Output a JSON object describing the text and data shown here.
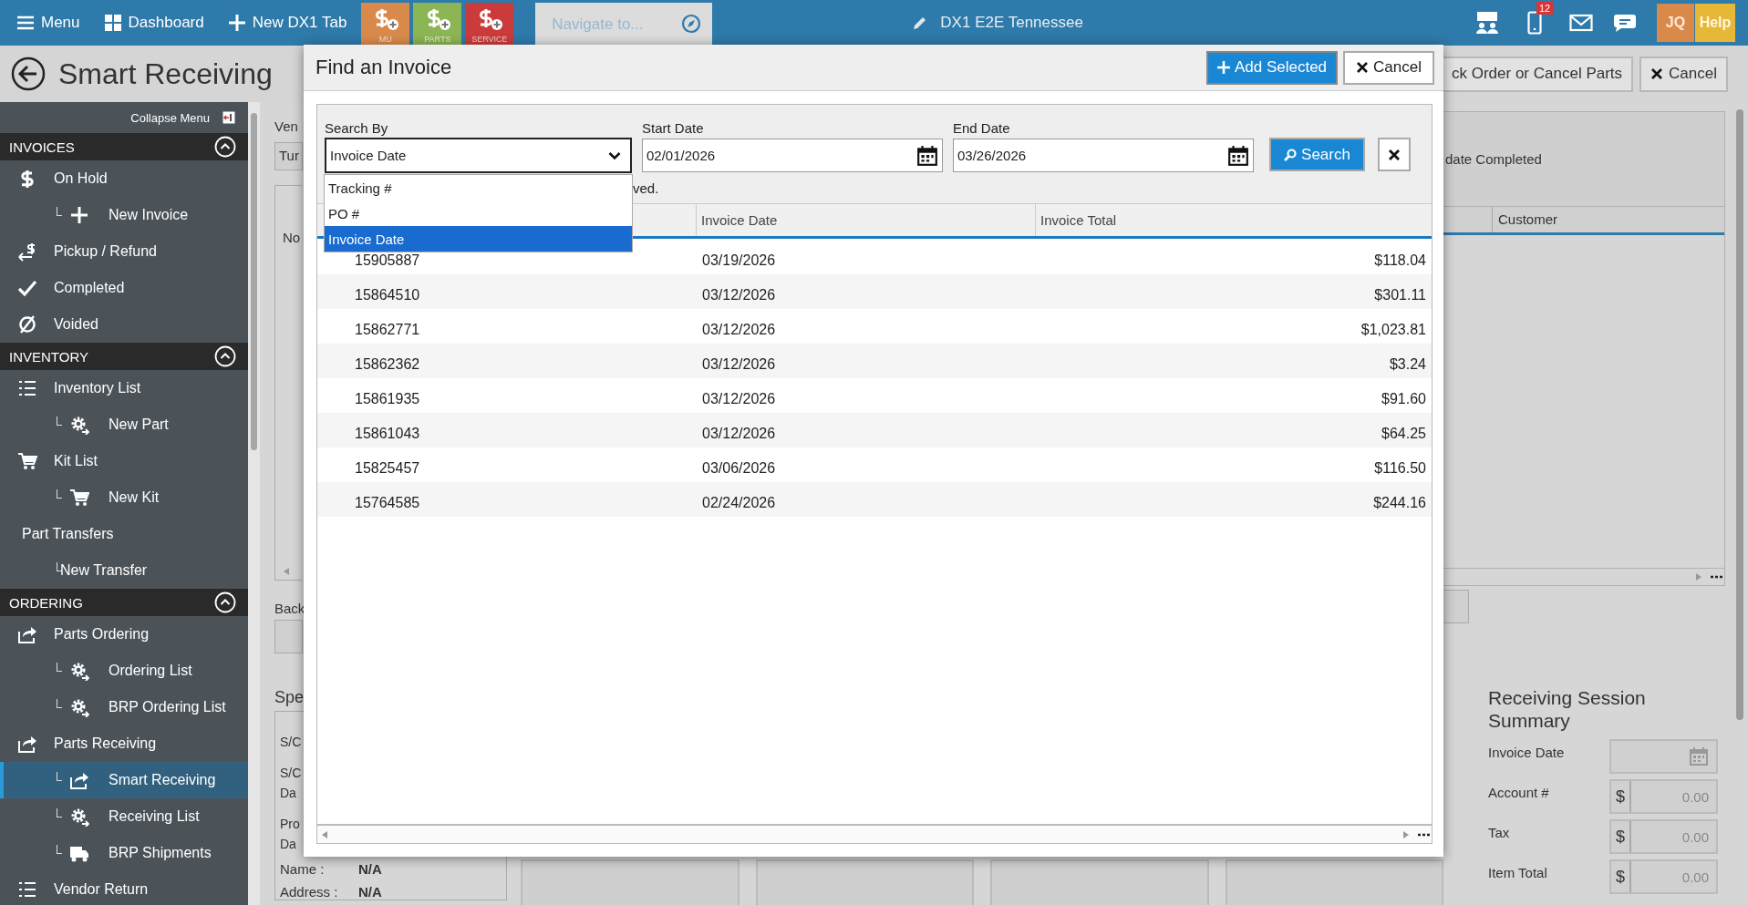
{
  "top_bar": {
    "menu": "Menu",
    "dashboard": "Dashboard",
    "new_tab": "New DX1 Tab",
    "tiles": [
      {
        "label": "MU",
        "color": "#d98a4b"
      },
      {
        "label": "PARTS",
        "color": "#8cb553"
      },
      {
        "label": "SERVICE",
        "color": "#cc3b3b"
      }
    ],
    "navigate": {
      "placeholder": "Navigate to..."
    },
    "location": "DX1 E2E Tennessee",
    "notification_count": "12",
    "user_initials": "JQ",
    "help": "Help"
  },
  "page": {
    "title": "Smart Receiving",
    "buttons": [
      "ck Order or Cancel Parts",
      "Cancel"
    ]
  },
  "sidebar": {
    "collapse_label": "Collapse Menu",
    "sections": [
      {
        "title": "INVOICES",
        "expanded": true,
        "items": [
          {
            "label": "On Hold",
            "kind": "main",
            "selected": false
          },
          {
            "label": "New Invoice",
            "kind": "sub",
            "selected": false
          },
          {
            "label": "Pickup / Refund",
            "kind": "main",
            "selected": false
          },
          {
            "label": "Completed",
            "kind": "main",
            "selected": false
          },
          {
            "label": "Voided",
            "kind": "main",
            "selected": false
          }
        ]
      },
      {
        "title": "INVENTORY",
        "expanded": true,
        "items": [
          {
            "label": "Inventory List",
            "kind": "main",
            "selected": false
          },
          {
            "label": "New Part",
            "kind": "sub",
            "selected": false
          },
          {
            "label": "Kit List",
            "kind": "main",
            "selected": false
          },
          {
            "label": "New Kit",
            "kind": "sub",
            "selected": false
          },
          {
            "label": "Part Transfers",
            "kind": "plain",
            "selected": false
          },
          {
            "label": "New Transfer",
            "kind": "branch",
            "selected": false
          }
        ]
      },
      {
        "title": "ORDERING",
        "expanded": true,
        "items": [
          {
            "label": "Parts Ordering",
            "kind": "main",
            "selected": false
          },
          {
            "label": "Ordering List",
            "kind": "sub",
            "selected": false
          },
          {
            "label": "BRP Ordering List",
            "kind": "sub",
            "selected": false
          },
          {
            "label": "Parts Receiving",
            "kind": "main",
            "selected": false
          },
          {
            "label": "Smart Receiving",
            "kind": "sub",
            "selected": true
          },
          {
            "label": "Receiving List",
            "kind": "sub",
            "selected": false
          },
          {
            "label": "BRP Shipments",
            "kind": "sub",
            "selected": false
          },
          {
            "label": "Vendor Return",
            "kind": "main",
            "selected": false
          }
        ]
      }
    ]
  },
  "background_left": {
    "vendor_label": "Ven",
    "vendor_value": "Tur",
    "grid_text": "No",
    "back_label": "Back",
    "special_title": "Spe",
    "special_labels": [
      "S/C",
      "S/C Da",
      "Pro Da"
    ],
    "special_rows": [
      {
        "label": "Name :",
        "value": "N/A"
      },
      {
        "label": "Address :",
        "value": "N/A"
      }
    ]
  },
  "background_right": {
    "status_text": "date Completed",
    "grid_column": "Customer",
    "summary_title": "Receiving Session Summary",
    "summary_fields": [
      {
        "label": "Invoice Date",
        "kind": "date"
      },
      {
        "label": "Account #",
        "kind": "money",
        "prefix": "$",
        "value": "0.00"
      },
      {
        "label": "Tax",
        "kind": "money",
        "prefix": "$",
        "value": "0.00"
      },
      {
        "label": "Item Total",
        "kind": "money",
        "prefix": "$",
        "value": "0.00"
      }
    ]
  },
  "dialog": {
    "title": "Find an Invoice",
    "add_button": "Add Selected",
    "cancel_button": "Cancel",
    "search_by": {
      "label": "Search By",
      "value": "Invoice Date",
      "expanded": true,
      "options": [
        {
          "label": "Tracking #",
          "selected": false
        },
        {
          "label": "PO #",
          "selected": false
        },
        {
          "label": "Invoice Date",
          "selected": true
        }
      ]
    },
    "start_date": {
      "label": "Start Date",
      "value": "02/01/2026"
    },
    "end_date": {
      "label": "End Date",
      "value": "03/26/2026"
    },
    "search_button": "Search",
    "notice": "ved.",
    "columns": [
      "Invoice Date",
      "Invoice Total"
    ],
    "rows": [
      {
        "invoice": "15905887",
        "date": "03/19/2026",
        "total": "$118.04"
      },
      {
        "invoice": "15864510",
        "date": "03/12/2026",
        "total": "$301.11"
      },
      {
        "invoice": "15862771",
        "date": "03/12/2026",
        "total": "$1,023.81"
      },
      {
        "invoice": "15862362",
        "date": "03/12/2026",
        "total": "$3.24"
      },
      {
        "invoice": "15861935",
        "date": "03/12/2026",
        "total": "$91.60"
      },
      {
        "invoice": "15861043",
        "date": "03/12/2026",
        "total": "$64.25"
      },
      {
        "invoice": "15825457",
        "date": "03/06/2026",
        "total": "$116.50"
      },
      {
        "invoice": "15764585",
        "date": "02/24/2026",
        "total": "$244.16"
      }
    ]
  }
}
